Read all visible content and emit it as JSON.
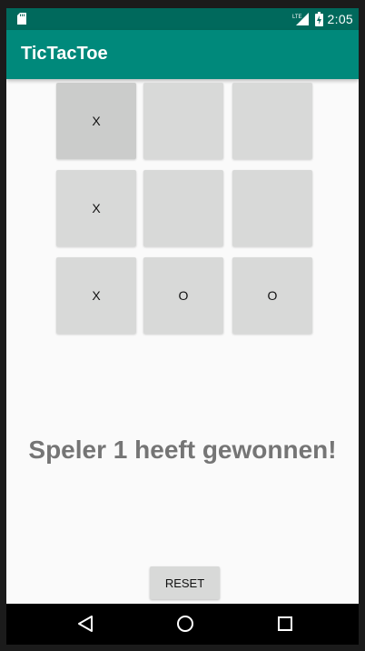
{
  "status_bar": {
    "time": "2:05",
    "network_label": "LTE",
    "icons": [
      "sd-card-icon",
      "signal-icon",
      "battery-charging-icon"
    ]
  },
  "app_bar": {
    "title": "TicTacToe"
  },
  "board": {
    "cells": [
      "X",
      "",
      "",
      "X",
      "",
      "",
      "X",
      "O",
      "O"
    ]
  },
  "result_text": "Speler 1 heeft gewonnen!",
  "reset_label": "RESET",
  "nav_bar": {
    "icons": [
      "back-icon",
      "home-icon",
      "recents-icon"
    ]
  },
  "colors": {
    "status_bar": "#00695c",
    "app_bar": "#00897b",
    "cell": "#d8d9d8",
    "result_text": "#757575"
  }
}
